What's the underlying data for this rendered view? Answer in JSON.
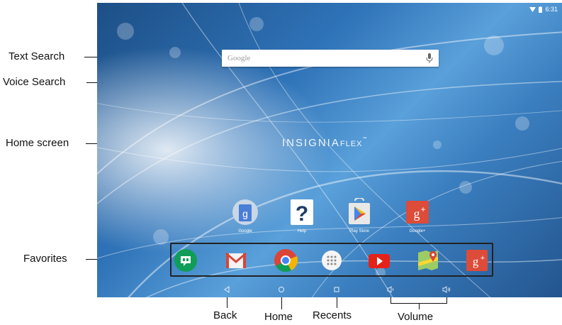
{
  "callouts": {
    "text_search": "Text Search",
    "voice_search": "Voice Search",
    "home_screen": "Home screen",
    "favorites": "Favorites",
    "back": "Back",
    "home": "Home",
    "recents": "Recents",
    "volume": "Volume"
  },
  "status": {
    "time": "6:31",
    "icons": [
      "wifi-icon",
      "battery-icon"
    ]
  },
  "search": {
    "placeholder": "Google",
    "mic_icon": "mic-icon"
  },
  "brand": {
    "name": "INSIGNIA",
    "suffix": "FLEX",
    "mark": "™"
  },
  "home_apps": [
    {
      "label": "Google",
      "icon": "google-search-icon"
    },
    {
      "label": "Help",
      "icon": "help-icon"
    },
    {
      "label": "Play Store",
      "icon": "play-store-icon"
    },
    {
      "label": "Google+",
      "icon": "google-plus-icon"
    }
  ],
  "favorites": [
    {
      "icon": "hangouts-icon"
    },
    {
      "icon": "gmail-icon"
    },
    {
      "icon": "chrome-icon"
    },
    {
      "icon": "app-drawer-icon"
    },
    {
      "icon": "youtube-icon"
    },
    {
      "icon": "maps-icon"
    },
    {
      "icon": "google-plus-icon"
    }
  ],
  "navbar": [
    "back-icon",
    "home-icon",
    "recents-icon",
    "volume-down-icon",
    "volume-up-icon"
  ],
  "colors": {
    "wallpaper_dark": "#1d4f86",
    "wallpaper_light": "#5aa0da",
    "gplus_red": "#dd4b39",
    "youtube_red": "#e62117"
  }
}
